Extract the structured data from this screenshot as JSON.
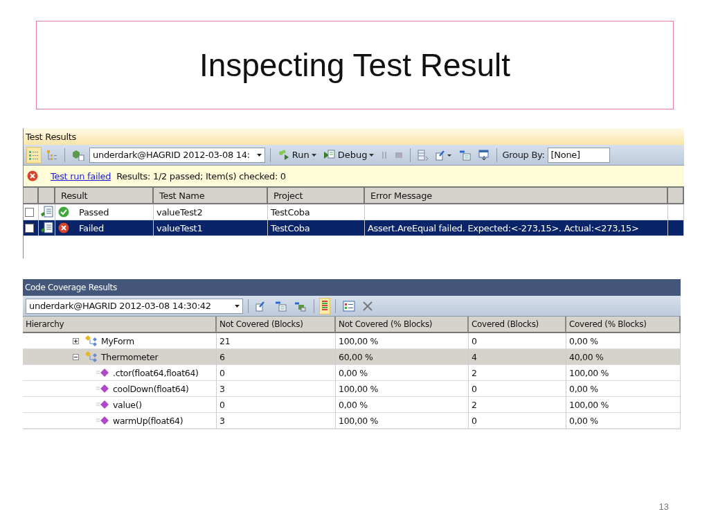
{
  "slide": {
    "title": "Inspecting Test Result",
    "page_number": "13"
  },
  "test_results": {
    "title": "Test Results",
    "run_selector": "underdark@HAGRID 2012-03-08 14:",
    "run": "Run",
    "debug": "Debug",
    "group_by_label": "Group By:",
    "group_by_value": "[None]",
    "status": {
      "kind": "failed",
      "link": "Test run failed",
      "text": "Results: 1/2 passed; Item(s) checked: 0"
    },
    "columns": [
      "Result",
      "Test Name",
      "Project",
      "Error Message"
    ],
    "rows": [
      {
        "kind": "passed",
        "checked": false,
        "selected": false,
        "result": "Passed",
        "test_name": "valueTest2",
        "project": "TestCoba"
      },
      {
        "kind": "failed",
        "checked": false,
        "selected": true,
        "result": "Failed",
        "test_name": "valueTest1",
        "project": "TestCoba",
        "error_message": "Assert.AreEqual failed. Expected:<-273,15>. Actual:<273,15>"
      }
    ]
  },
  "coverage": {
    "title": "Code Coverage Results",
    "run_selector": "underdark@HAGRID 2012-03-08 14:30:42",
    "columns": [
      "Hierarchy",
      "Not Covered (Blocks)",
      "Not Covered (% Blocks)",
      "Covered (Blocks)",
      "Covered (% Blocks)"
    ],
    "rows": [
      {
        "kind": "class",
        "name": "MyForm",
        "expanded": false,
        "selected": false,
        "values": [
          "21",
          "100,00 %",
          "0",
          "0,00 %"
        ]
      },
      {
        "kind": "class",
        "name": "Thermometer",
        "expanded": true,
        "selected": true,
        "values": [
          "6",
          "60,00 %",
          "4",
          "40,00 %"
        ],
        "children": [
          {
            "kind": "method",
            "name": ".ctor(float64,float64)",
            "selected": false,
            "values": [
              "0",
              "0,00 %",
              "2",
              "100,00 %"
            ]
          },
          {
            "kind": "method",
            "name": "coolDown(float64)",
            "selected": false,
            "values": [
              "3",
              "100,00 %",
              "0",
              "0,00 %"
            ]
          },
          {
            "kind": "method",
            "name": "value()",
            "selected": false,
            "values": [
              "0",
              "0,00 %",
              "2",
              "100,00 %"
            ]
          },
          {
            "kind": "method",
            "name": "warmUp(float64)",
            "selected": false,
            "values": [
              "3",
              "100,00 %",
              "0",
              "0,00 %"
            ]
          }
        ]
      }
    ]
  }
}
